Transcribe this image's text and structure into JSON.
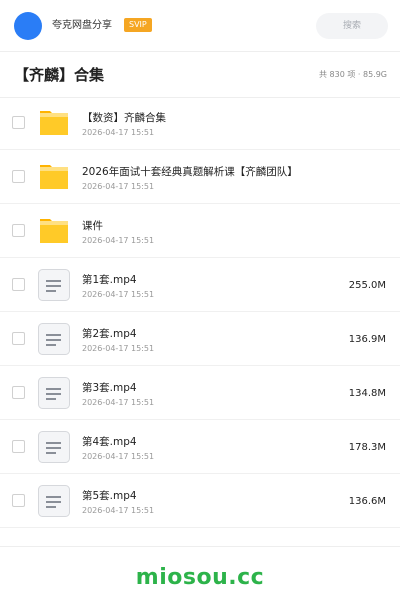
{
  "header": {
    "app_name": "夸克网盘分享",
    "badge": "SVIP",
    "search_placeholder": "搜索",
    "avatar_color": "#2a7df6",
    "badge_color": "#f5a623"
  },
  "folder": {
    "title": "【齐麟】合集",
    "summary": "共 830 项 · 85.9G"
  },
  "files": [
    {
      "type": "folder",
      "icon": "folder-icon",
      "name": "【数资】齐麟合集",
      "date": "2026-04-17 15:51",
      "size": ""
    },
    {
      "type": "folder",
      "icon": "folder-icon",
      "name": "2026年面试十套经典真题解析课【齐麟团队】",
      "date": "2026-04-17 15:51",
      "size": ""
    },
    {
      "type": "folder",
      "icon": "folder-icon",
      "name": "课件",
      "date": "2026-04-17 15:51",
      "size": ""
    },
    {
      "type": "file",
      "icon": "document-icon",
      "name": "第1套.mp4",
      "date": "2026-04-17 15:51",
      "size": "255.0M"
    },
    {
      "type": "file",
      "icon": "document-icon",
      "name": "第2套.mp4",
      "date": "2026-04-17 15:51",
      "size": "136.9M"
    },
    {
      "type": "file",
      "icon": "document-icon",
      "name": "第3套.mp4",
      "date": "2026-04-17 15:51",
      "size": "134.8M"
    },
    {
      "type": "file",
      "icon": "document-icon",
      "name": "第4套.mp4",
      "date": "2026-04-17 15:51",
      "size": "178.3M"
    },
    {
      "type": "file",
      "icon": "document-icon",
      "name": "第5套.mp4",
      "date": "2026-04-17 15:51",
      "size": "136.6M"
    }
  ],
  "footer": {
    "watermark": "miosou.cc",
    "watermark_color": "#2db34a"
  }
}
